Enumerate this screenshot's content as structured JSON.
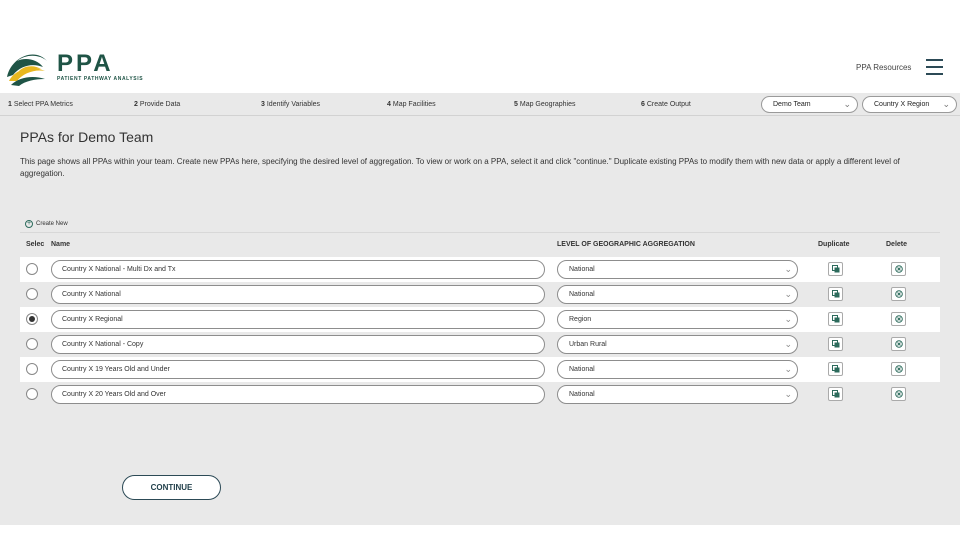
{
  "brand": {
    "name": "PPA",
    "subtitle": "PATIENT PATHWAY ANALYSIS",
    "colors": {
      "primary": "#1f5446",
      "accent": "#e8b820",
      "dark": "#2c4a56"
    }
  },
  "header": {
    "resources_link": "PPA Resources",
    "menu_icon": "hamburger-icon"
  },
  "steps": [
    {
      "num": "1",
      "label": "Select PPA Metrics"
    },
    {
      "num": "2",
      "label": "Provide Data"
    },
    {
      "num": "3",
      "label": "Identify Variables"
    },
    {
      "num": "4",
      "label": "Map Facilities"
    },
    {
      "num": "5",
      "label": "Map Geographies"
    },
    {
      "num": "6",
      "label": "Create Output"
    }
  ],
  "team_select": {
    "value": "Demo Team"
  },
  "country_select": {
    "value": "Country X Region"
  },
  "page": {
    "title": "PPAs for Demo Team",
    "intro": "This page shows all PPAs within your team. Create new PPAs here, specifying the desired level of aggregation. To view or work on a PPA, select it and click \"continue.\" Duplicate existing PPAs to modify them with new data or apply a different level of aggregation."
  },
  "create_new_label": "Create New",
  "table": {
    "headers": {
      "select": "Selec",
      "name": "Name",
      "aggregation": "LEVEL OF GEOGRAPHIC AGGREGATION",
      "duplicate": "Duplicate",
      "delete": "Delete"
    },
    "rows": [
      {
        "name": "Country X National - Multi Dx and Tx",
        "aggregation": "National",
        "selected": false
      },
      {
        "name": "Country X National",
        "aggregation": "National",
        "selected": false
      },
      {
        "name": "Country X Regional",
        "aggregation": "Region",
        "selected": true
      },
      {
        "name": "Country X National - Copy",
        "aggregation": "Urban Rural",
        "selected": false
      },
      {
        "name": "Country X 19 Years Old and Under",
        "aggregation": "National",
        "selected": false
      },
      {
        "name": "Country X 20 Years Old and Over",
        "aggregation": "National",
        "selected": false
      }
    ]
  },
  "continue_label": "CONTINUE"
}
